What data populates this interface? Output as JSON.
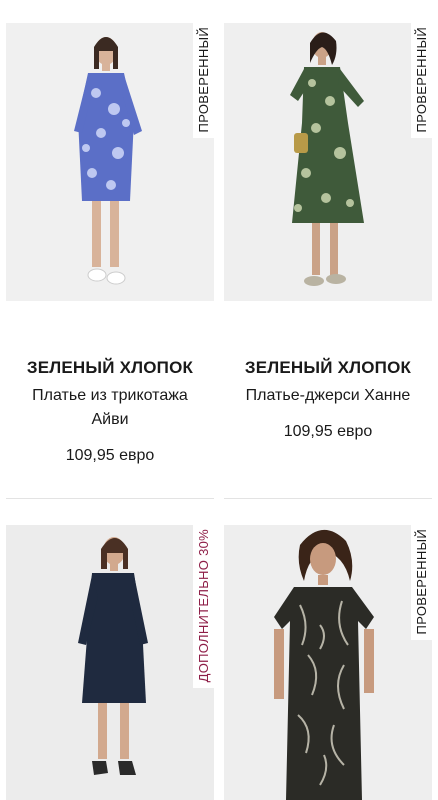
{
  "products": [
    {
      "badge": "ПРОВЕРЕННЫЙ",
      "brand": "ЗЕЛЕНЫЙ ХЛОПОК",
      "name": "Платье из трикотажа Айви",
      "price": "109,95  евро",
      "dress_color": "#5b6fc7",
      "image": "blue-floral-dress-photo"
    },
    {
      "badge": "ПРОВЕРЕННЫЙ",
      "brand": "ЗЕЛЕНЫЙ ХЛОПОК",
      "name": "Платье-джерси Ханне",
      "price": "109,95  евро",
      "dress_color": "#3f5a3a",
      "image": "green-floral-dress-photo"
    },
    {
      "badge": "ДОПОЛНИТЕЛЬНО 30%",
      "dress_color": "#1f2a3f",
      "image": "navy-dress-photo"
    },
    {
      "badge": "ПРОВЕРЕННЫЙ",
      "dress_color": "#2b2b26",
      "image": "leaf-print-dress-photo"
    }
  ]
}
